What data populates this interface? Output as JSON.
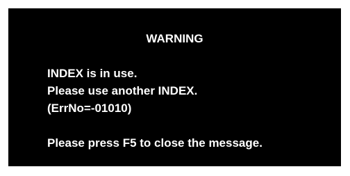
{
  "dialog": {
    "title": "WARNING",
    "message_lines": [
      "INDEX is in use.",
      "Please use another INDEX.",
      "(ErrNo=-01010)"
    ],
    "instruction": "Please press F5 to close the message.",
    "colors": {
      "background": "#000000",
      "text": "#ffffff"
    }
  }
}
